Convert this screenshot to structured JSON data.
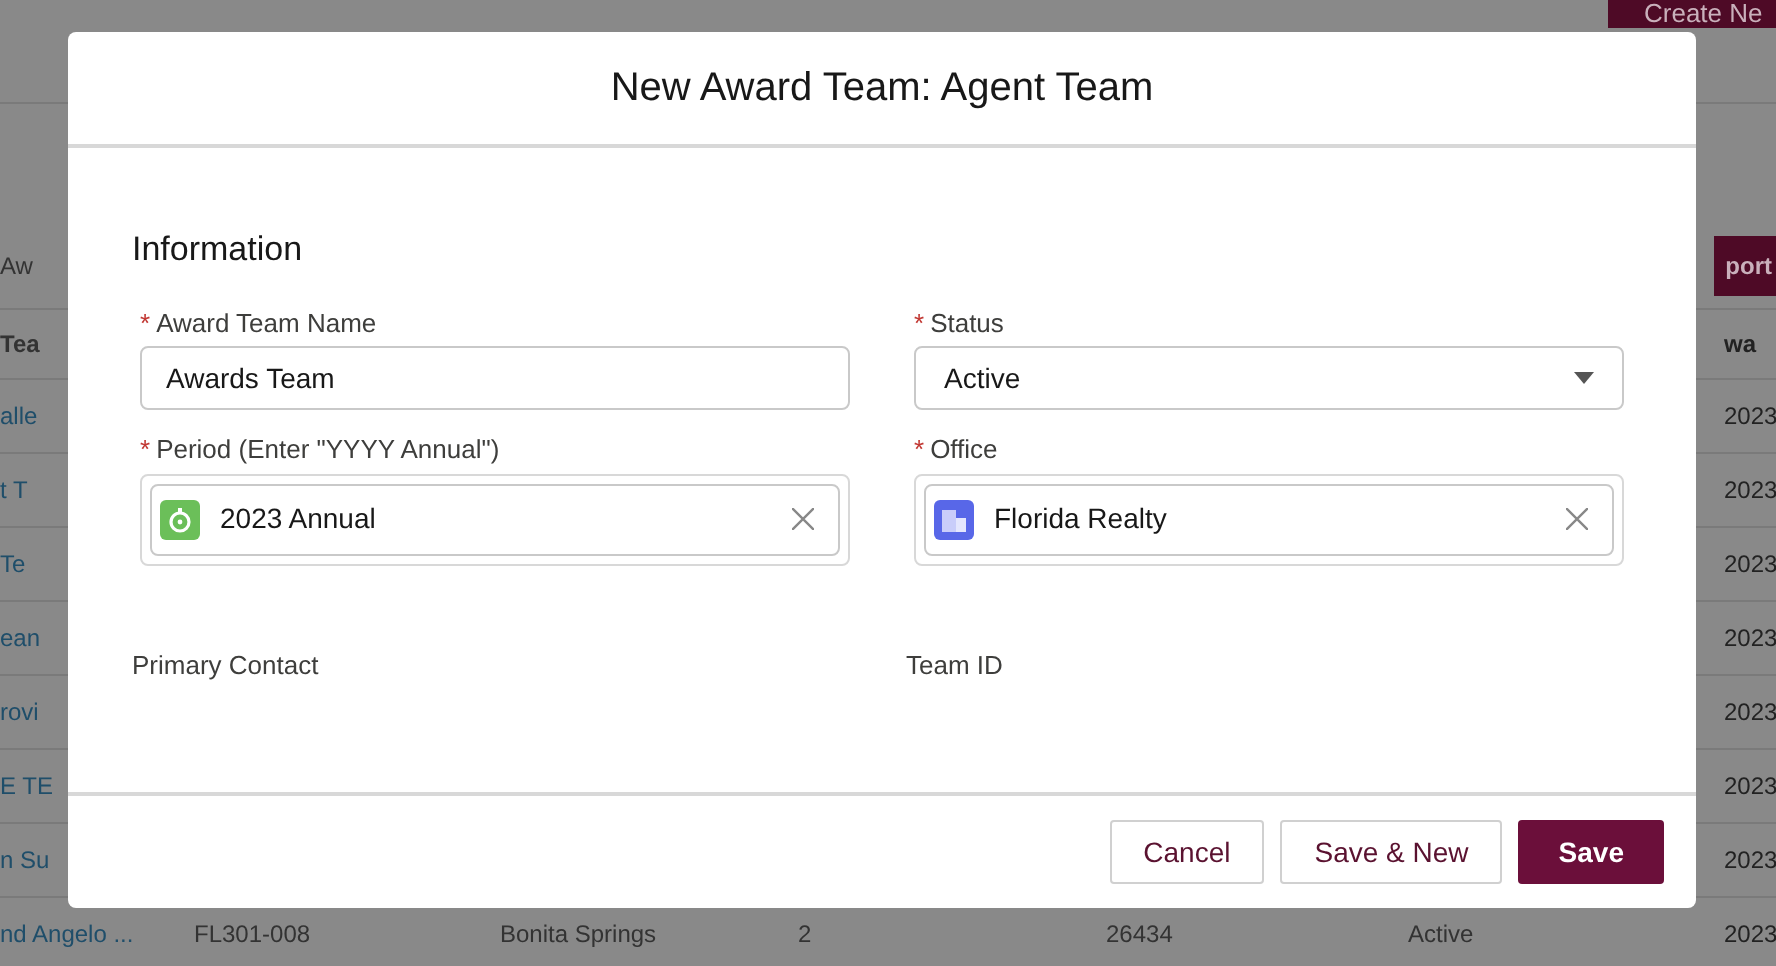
{
  "background": {
    "create_button": "Create Ne",
    "toolbar_text": "Aw",
    "report_button": "port",
    "table": {
      "header": {
        "column_1": "Tea",
        "column_7": "wa"
      },
      "rows": [
        {
          "column_1": "alle",
          "column_7": "2023"
        },
        {
          "column_1": "t T",
          "column_7": "2023"
        },
        {
          "column_1": "Te",
          "column_7": "2023"
        },
        {
          "column_1": "ean",
          "column_7": "2023"
        },
        {
          "column_1": "rovi",
          "column_7": "2023"
        },
        {
          "column_1": "E TE",
          "column_7": "2023"
        },
        {
          "column_1": "n Su",
          "column_7": "2023"
        },
        {
          "column_1": "nd Angelo ...",
          "column_2": "FL301-008",
          "column_3": "Bonita Springs",
          "column_4": "2",
          "column_5": "26434",
          "column_6": "Active",
          "column_7": "2023"
        }
      ]
    }
  },
  "modal": {
    "title": "New Award Team: Agent Team",
    "section": "Information",
    "fields": [
      {
        "kind": "text",
        "label": "Award Team Name",
        "required_mark": "*",
        "value": "Awards Team"
      },
      {
        "kind": "picklist",
        "label": "Status",
        "required_mark": "*",
        "value": "Active"
      },
      {
        "kind": "lookup",
        "label": "Period (Enter \"YYYY Annual\")",
        "required_mark": "*",
        "value": "2023 Annual"
      },
      {
        "kind": "lookup",
        "label": "Office",
        "required_mark": "*",
        "value": "Florida Realty"
      },
      {
        "kind": "readonly",
        "label": "Primary Contact"
      },
      {
        "kind": "readonly",
        "label": "Team ID"
      }
    ],
    "buttons": [
      {
        "label": "Cancel",
        "kind": "secondary"
      },
      {
        "label": "Save & New",
        "kind": "secondary"
      },
      {
        "label": "Save",
        "kind": "primary"
      }
    ]
  }
}
